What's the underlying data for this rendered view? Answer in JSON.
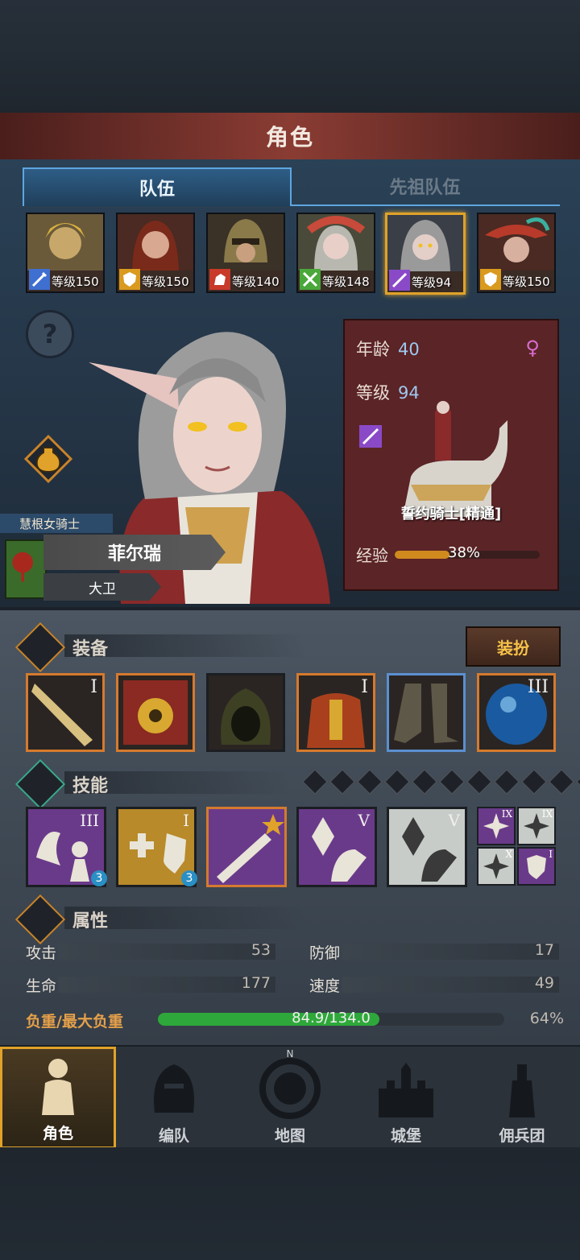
{
  "title": "角色",
  "tabs": [
    {
      "label": "队伍",
      "active": true
    },
    {
      "label": "先祖队伍",
      "active": false
    }
  ],
  "roster": [
    {
      "level_label": "等级150",
      "selected": false,
      "class_icon": "sword-icon",
      "class_color": "#3f6fd0"
    },
    {
      "level_label": "等级150",
      "selected": false,
      "class_icon": "shield-icon",
      "class_color": "#d99a1e"
    },
    {
      "level_label": "等级140",
      "selected": false,
      "class_icon": "horse-icon",
      "class_color": "#c83a2a"
    },
    {
      "level_label": "等级148",
      "selected": false,
      "class_icon": "crossed-swords-icon",
      "class_color": "#4aa83a"
    },
    {
      "level_label": "等级94",
      "selected": true,
      "class_icon": "lance-icon",
      "class_color": "#8a4ac8"
    },
    {
      "level_label": "等级150",
      "selected": false,
      "class_icon": "shield-icon",
      "class_color": "#d99a1e"
    }
  ],
  "character": {
    "title": "慧根女骑士",
    "name": "菲尔瑞",
    "subtitle": "大卫",
    "age_label": "年龄",
    "age": "40",
    "level_label": "等级",
    "level": "94",
    "class_name": "誓约骑士[精通]",
    "exp_label": "经验",
    "exp_percent_text": "38%",
    "exp_fraction": 0.38
  },
  "equipment": {
    "label": "装备",
    "outfit_button": "装扮",
    "slots": [
      {
        "name": "weapon-slot",
        "tier": "I",
        "rarity": "orange"
      },
      {
        "name": "shield-slot",
        "tier": "",
        "rarity": "orange"
      },
      {
        "name": "helmet-slot",
        "tier": "",
        "rarity": "none"
      },
      {
        "name": "armor-slot",
        "tier": "I",
        "rarity": "orange"
      },
      {
        "name": "boots-slot",
        "tier": "",
        "rarity": "blue"
      },
      {
        "name": "orb-slot",
        "tier": "III",
        "rarity": "orange"
      }
    ]
  },
  "skills": {
    "label": "技能",
    "points": 11,
    "items": [
      {
        "tier": "III",
        "level": "3",
        "bg": "#6a3a8a"
      },
      {
        "tier": "I",
        "level": "3",
        "bg": "#b88a2a"
      },
      {
        "tier": "",
        "level": "",
        "bg": "#6a3a8a"
      },
      {
        "tier": "V",
        "level": "",
        "bg": "#6a3a8a"
      },
      {
        "tier": "V",
        "level": "",
        "bg": "#c8ccc8"
      }
    ],
    "mini": [
      {
        "tier": "IX",
        "bg": "#6a3a8a"
      },
      {
        "tier": "IX",
        "bg": "#c8ccc8"
      },
      {
        "tier": "X",
        "bg": "#c8ccc8"
      },
      {
        "tier": "I",
        "bg": "#6a3a8a"
      }
    ]
  },
  "attributes": {
    "label": "属性",
    "attack_label": "攻击",
    "attack": "53",
    "defense_label": "防御",
    "defense": "17",
    "hp_label": "生命",
    "hp": "177",
    "speed_label": "速度",
    "speed": "49",
    "carry_label": "负重/最大负重",
    "carry_text": "84.9/134.0",
    "carry_percent": "64%",
    "carry_fraction": 0.64
  },
  "nav": [
    {
      "label": "角色",
      "active": true,
      "icon": "knight-icon"
    },
    {
      "label": "编队",
      "active": false,
      "icon": "helmet-icon"
    },
    {
      "label": "地图",
      "active": false,
      "icon": "compass-icon"
    },
    {
      "label": "城堡",
      "active": false,
      "icon": "castle-icon"
    },
    {
      "label": "佣兵团",
      "active": false,
      "icon": "mercenary-icon"
    }
  ],
  "compass_letter": "N"
}
